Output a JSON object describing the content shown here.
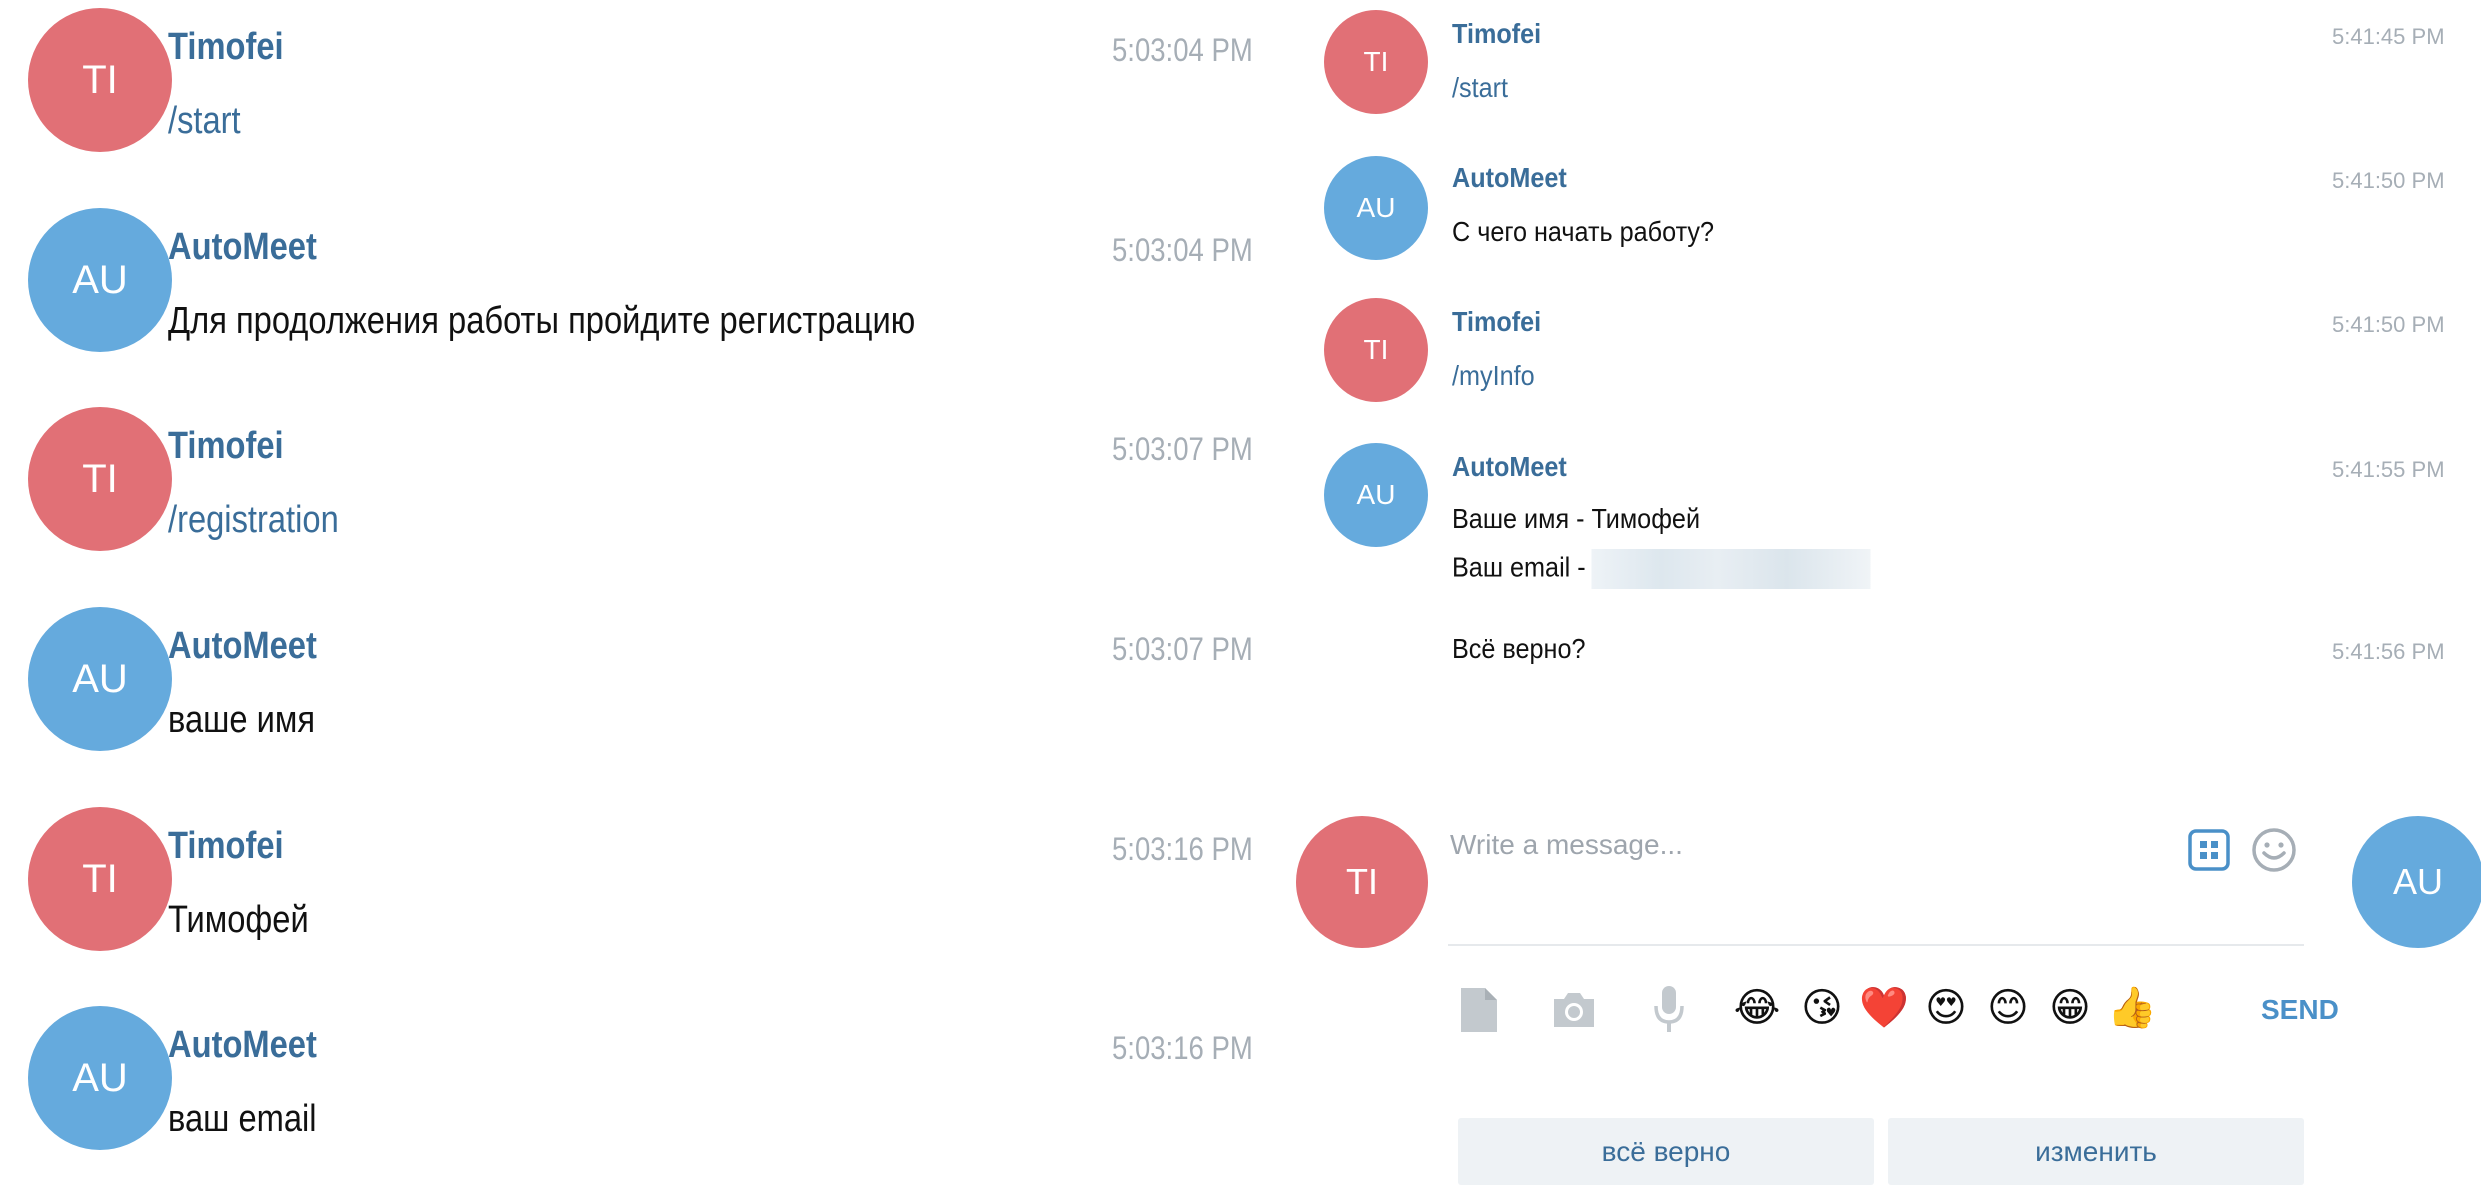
{
  "left_chat": {
    "messages": [
      {
        "author": "Timofei",
        "initials": "TI",
        "time": "5:03:04 PM",
        "text": "/start",
        "is_command": true
      },
      {
        "author": "AutoMeet",
        "initials": "AU",
        "time": "5:03:04 PM",
        "text": "Для продолжения работы пройдите регистрацию",
        "is_command": false
      },
      {
        "author": "Timofei",
        "initials": "TI",
        "time": "5:03:07 PM",
        "text": "/registration",
        "is_command": true
      },
      {
        "author": "AutoMeet",
        "initials": "AU",
        "time": "5:03:07 PM",
        "text": "ваше имя",
        "is_command": false
      },
      {
        "author": "Timofei",
        "initials": "TI",
        "time": "5:03:16 PM",
        "text": "Тимофей",
        "is_command": false
      },
      {
        "author": "AutoMeet",
        "initials": "AU",
        "time": "5:03:16 PM",
        "text": "ваш email",
        "is_command": false
      }
    ]
  },
  "right_chat": {
    "messages": [
      {
        "author": "Timofei",
        "initials": "TI",
        "time": "5:41:45 PM",
        "text": "/start"
      },
      {
        "author": "AutoMeet",
        "initials": "AU",
        "time": "5:41:50 PM",
        "text": "С чего начать работу?"
      },
      {
        "author": "Timofei",
        "initials": "TI",
        "time": "5:41:50 PM",
        "text": "/myInfo"
      },
      {
        "author": "AutoMeet",
        "initials": "AU",
        "time": "5:41:55 PM",
        "line1": "Ваше имя - Тимофей",
        "line2": "Ваш email -"
      },
      {
        "time": "5:41:56 PM",
        "text": "Всё верно?"
      }
    ]
  },
  "composer": {
    "my_initials": "TI",
    "bot_initials": "AU",
    "placeholder": "Write a message...",
    "send_label": "SEND",
    "icons": [
      "keyboard-icon",
      "smile-icon",
      "file-icon",
      "camera-icon",
      "microphone-icon"
    ],
    "quick_emojis": [
      "😂",
      "😘",
      "❤️",
      "😍",
      "😊",
      "😁",
      "👍"
    ]
  },
  "keyboard_buttons": [
    "всё верно",
    "изменить"
  ],
  "colors": {
    "user_avatar": "#e17076",
    "bot_avatar": "#65aadd",
    "name": "#3a6d99",
    "time": "#a6aeb6",
    "send": "#4a90c8",
    "keyboard_button_bg": "#eef2f5"
  }
}
